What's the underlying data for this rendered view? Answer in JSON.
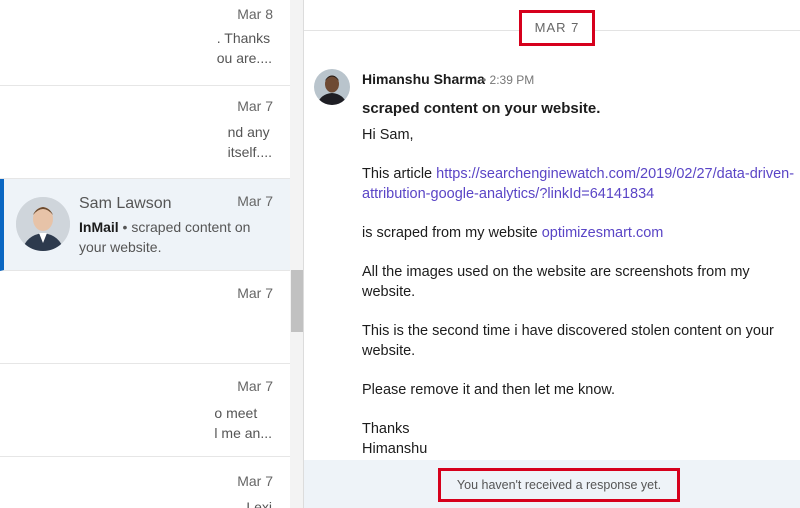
{
  "conversations": [
    {
      "date": "Mar 8",
      "snippet_lines": [
        ". Thanks",
        "ou are...."
      ]
    },
    {
      "date": "Mar 7",
      "snippet_lines": [
        "nd any",
        "itself...."
      ]
    },
    {
      "date": "Mar 7",
      "sender": "Sam Lawson",
      "tag": "InMail",
      "preview": "scraped content on your website.",
      "active": true
    },
    {
      "date": "Mar 7",
      "snippet_lines": []
    },
    {
      "date": "Mar 7",
      "snippet_lines": [
        "o meet",
        "l me an..."
      ]
    },
    {
      "date": "Mar 7",
      "snippet_lines": [
        "Lexi"
      ]
    }
  ],
  "thread": {
    "date_separator": "MAR 7",
    "author": "Himanshu Sharma",
    "time": "• 2:39 PM",
    "subject": "scraped content on your website.",
    "greeting": "Hi Sam,",
    "article_prefix": "This article ",
    "article_link": "https://searchenginewatch.com/2019/02/27/data-driven-attribution-google-analytics/?linkId=64141834",
    "scraped_prefix": "is scraped from my website ",
    "scraped_link": "optimizesmart.com",
    "images_line": "All the images used on the website are screenshots from my website.",
    "second_time_line": "This is the second time i have discovered stolen content on your website.",
    "remove_line": "Please remove it and then let me know.",
    "signoff": "Thanks",
    "signature": "Himanshu"
  },
  "footer": {
    "status": "You haven't received a response yet."
  },
  "colors": {
    "accent": "#0a66c2",
    "highlight_border": "#d6001c",
    "link": "#5a45c6"
  }
}
